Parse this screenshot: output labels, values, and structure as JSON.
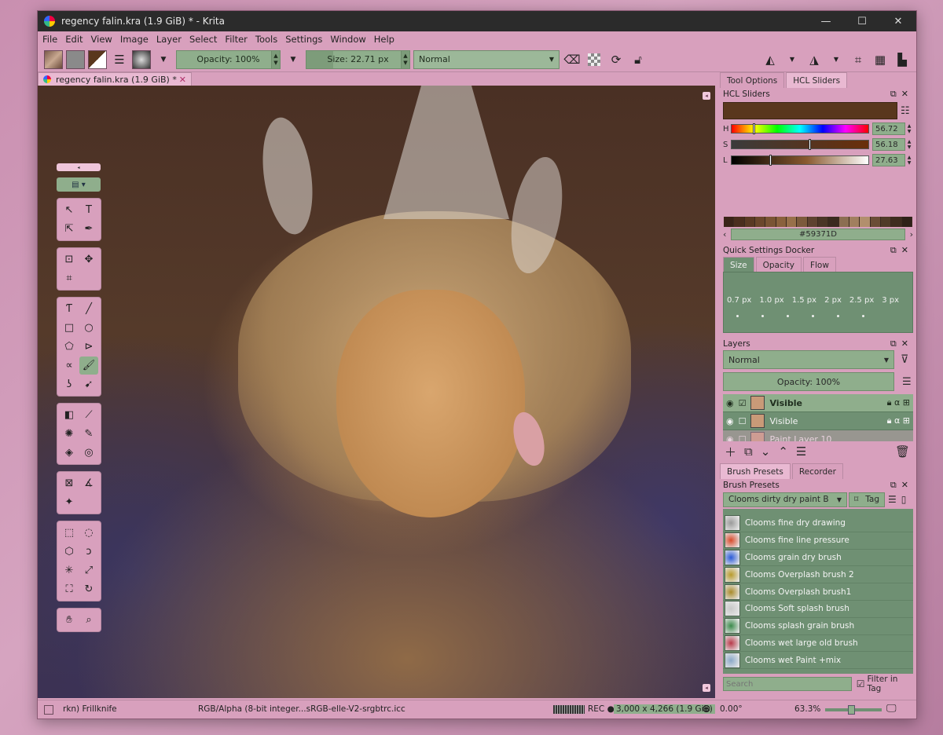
{
  "window": {
    "title": "regency falin.kra (1.9 GiB) * - Krita",
    "minimize": "—",
    "maximize": "☐",
    "close": "✕"
  },
  "menu": [
    "File",
    "Edit",
    "View",
    "Image",
    "Layer",
    "Select",
    "Filter",
    "Tools",
    "Settings",
    "Window",
    "Help"
  ],
  "toolbar": {
    "opacity": "Opacity: 100%",
    "size": "Size: 22.71 px",
    "blend_mode": "Normal"
  },
  "document_tab": {
    "label": "regency falin.kra (1.9 GiB) *",
    "close": "✕"
  },
  "dock": {
    "tabs": [
      "Tool Options",
      "HCL Sliders"
    ],
    "hcl": {
      "header": "HCL Sliders",
      "color": "#59371d",
      "sliders": [
        {
          "label": "H",
          "value": "56.72",
          "fraction": 0.158
        },
        {
          "label": "S",
          "value": "56.18",
          "fraction": 0.562
        },
        {
          "label": "L",
          "value": "27.63",
          "fraction": 0.276
        }
      ],
      "hex": "#59371D",
      "swatches": [
        "#3a2418",
        "#4a2e1e",
        "#5a3a24",
        "#6b472c",
        "#7a5434",
        "#8a613d",
        "#98704a",
        "#7c5a3c",
        "#5e4230",
        "#4a3526",
        "#3a2a1e",
        "#8c6e52",
        "#a17f5f",
        "#b28f6d",
        "#6b4d36",
        "#503a28",
        "#3e2c1f",
        "#2e2118"
      ]
    },
    "quick_settings": {
      "header": "Quick Settings Docker",
      "tabs": [
        "Size",
        "Opacity",
        "Flow"
      ],
      "sizes": [
        "0.7 px",
        "1.0 px",
        "1.5 px",
        "2 px",
        "2.5 px",
        "3 px"
      ]
    },
    "layers": {
      "header": "Layers",
      "blend": "Normal",
      "opacity": "Opacity: 100%",
      "items": [
        {
          "name": "Visible",
          "selected": true
        },
        {
          "name": "Visible",
          "selected": false
        },
        {
          "name": "Paint Layer 10",
          "selected": false
        }
      ]
    },
    "brush_tabs": [
      "Brush Presets",
      "Recorder"
    ],
    "brush_presets": {
      "header": "Brush Presets",
      "current": "Clooms dirty dry paint B",
      "tag": "Tag",
      "items": [
        {
          "name": "Clooms fine dry drawing",
          "color": "#9a9a9a"
        },
        {
          "name": "Clooms fine line pressure",
          "color": "#d84a2a"
        },
        {
          "name": "Clooms grain dry brush",
          "color": "#2a5ad8"
        },
        {
          "name": "Clooms Overplash brush 2",
          "color": "#b89a2a"
        },
        {
          "name": "Clooms Overplash brush1",
          "color": "#a88a2a"
        },
        {
          "name": "Clooms Soft splash brush",
          "color": "#c8c8c8"
        },
        {
          "name": "Clooms splash grain brush",
          "color": "#3a8a4a"
        },
        {
          "name": "Clooms wet large old brush",
          "color": "#b83a4a"
        },
        {
          "name": "Clooms wet Paint +mix",
          "color": "#8aa8c8"
        }
      ],
      "search_placeholder": "Search",
      "filter_in_tag": "Filter in Tag"
    }
  },
  "status": {
    "brush": "rkn) Frillknife",
    "colorspace": "RGB/Alpha (8-bit integer...sRGB-elle-V2-srgbtrc.icc",
    "rec": "REC ●",
    "dimensions": "3,000 x 4,266 (1.9 GiB)",
    "rotation": "0.00°",
    "zoom": "63.3%",
    "zoom_fraction": 0.45
  }
}
